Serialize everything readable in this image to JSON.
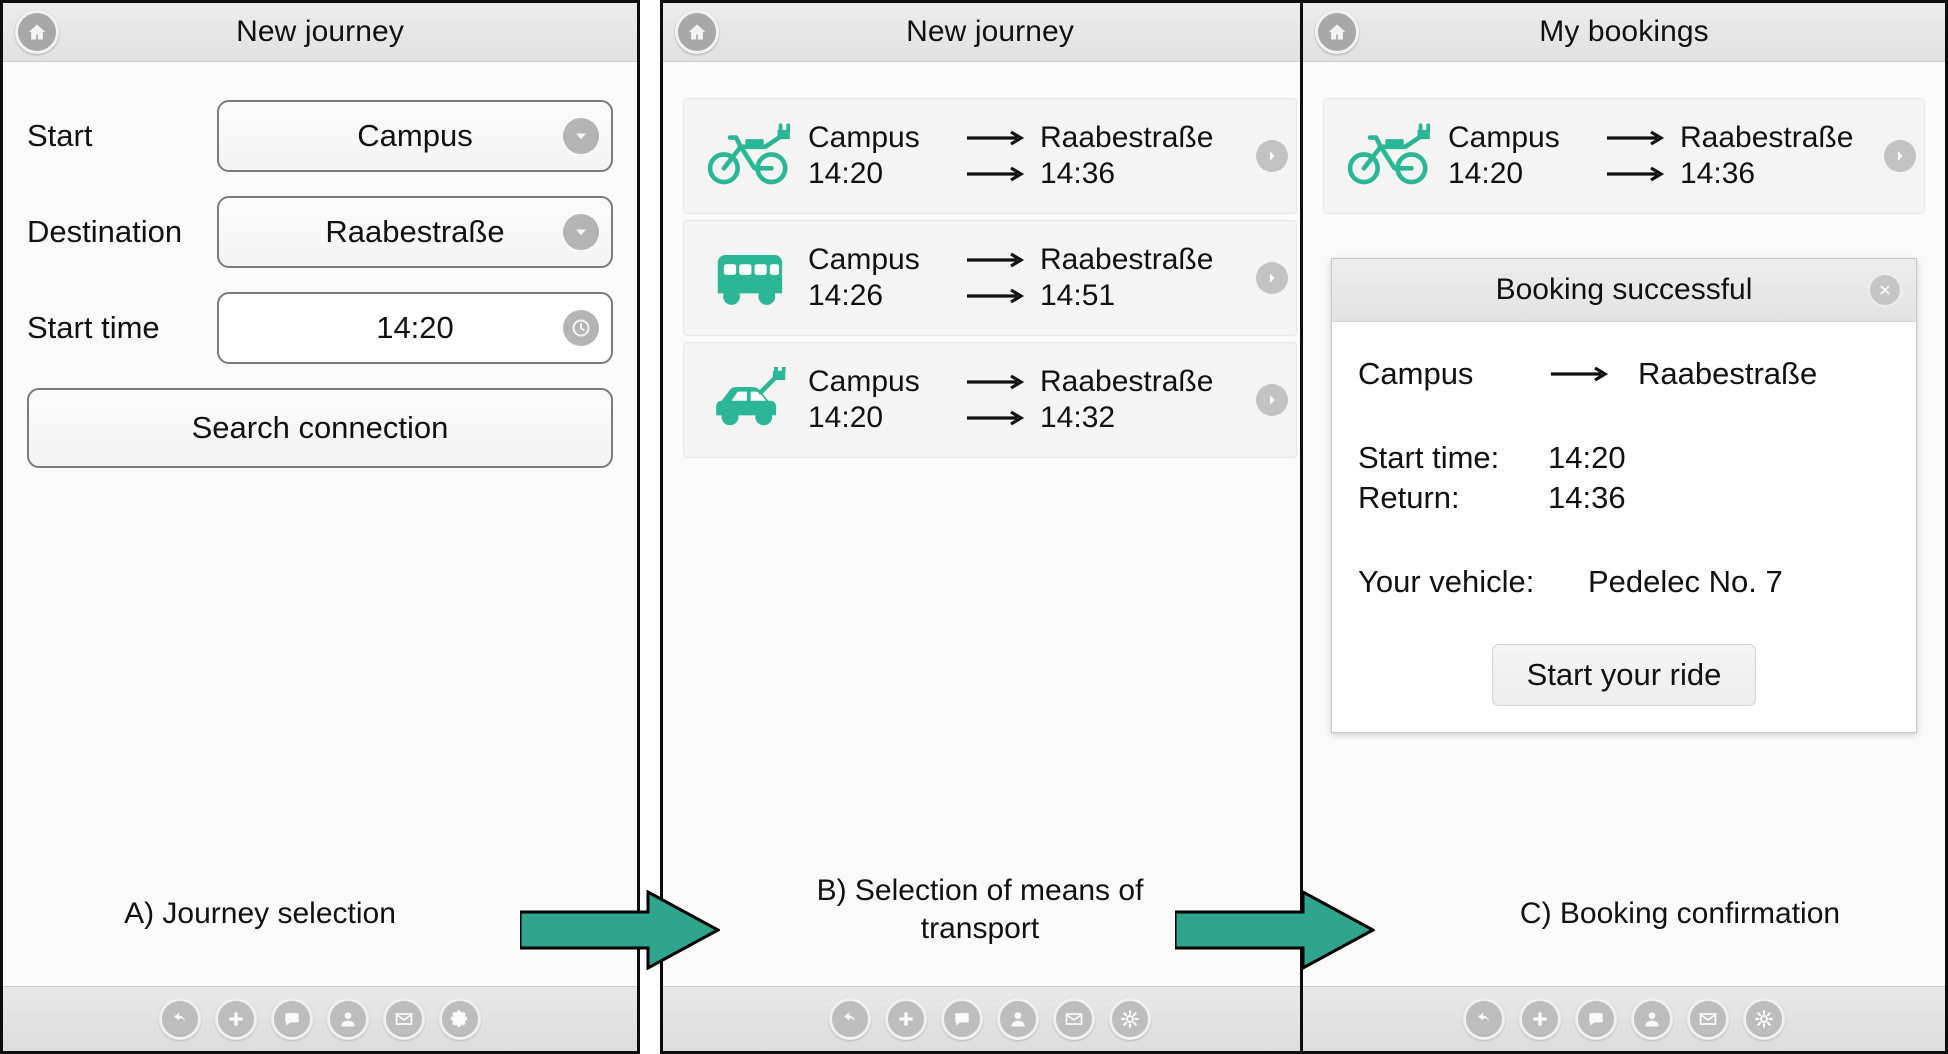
{
  "accent_green": "#2BB795",
  "panels": [
    {
      "id": "a",
      "title": "New journey",
      "caption": "A) Journey selection",
      "form": {
        "start_label": "Start",
        "start_value": "Campus",
        "destination_label": "Destination",
        "destination_value": "Raabestraße",
        "starttime_label": "Start time",
        "starttime_value": "14:20",
        "search_button": "Search connection"
      }
    },
    {
      "id": "b",
      "title": "New journey",
      "caption": "B) Selection of means of transport",
      "connections": [
        {
          "vehicle": "pedelec-icon",
          "from": "Campus",
          "to": "Raabestraße",
          "depart": "14:20",
          "arrive": "14:36"
        },
        {
          "vehicle": "bus-icon",
          "from": "Campus",
          "to": "Raabestraße",
          "depart": "14:26",
          "arrive": "14:51"
        },
        {
          "vehicle": "electric-car-icon",
          "from": "Campus",
          "to": "Raabestraße",
          "depart": "14:20",
          "arrive": "14:32"
        }
      ]
    },
    {
      "id": "c",
      "title": "My bookings",
      "caption": "C) Booking confirmation",
      "booking": {
        "vehicle": "pedelec-icon",
        "from": "Campus",
        "to": "Raabestraße",
        "depart": "14:20",
        "arrive": "14:36"
      },
      "dialog": {
        "title": "Booking successful",
        "close_icon": "close-icon",
        "route_from": "Campus",
        "route_to": "Raabestraße",
        "starttime_label": "Start time:",
        "starttime_value": "14:20",
        "return_label": "Return:",
        "return_value": "14:36",
        "vehicle_label": "Your vehicle:",
        "vehicle_value": "Pedelec No. 7",
        "action_button": "Start your ride"
      }
    }
  ],
  "toolbar": {
    "icons": [
      "undo-icon",
      "plus-icon",
      "chat-bubble-icon",
      "person-icon",
      "envelope-icon",
      "gear-icon"
    ]
  }
}
